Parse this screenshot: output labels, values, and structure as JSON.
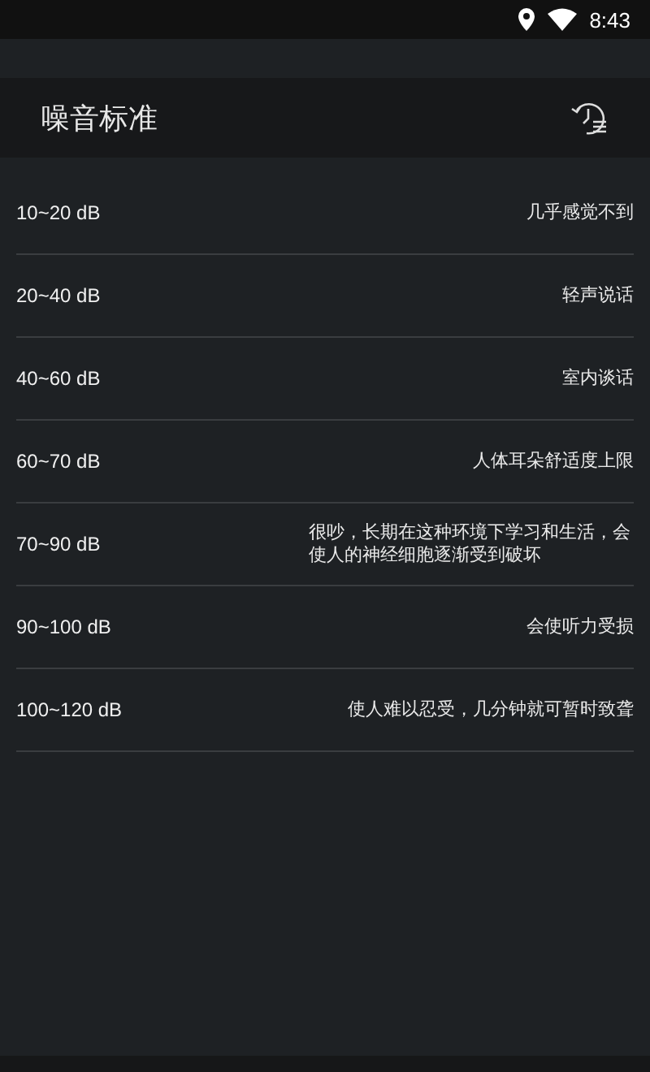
{
  "status_bar": {
    "time": "8:43"
  },
  "header": {
    "title": "噪音标准"
  },
  "rows": [
    {
      "range": "10~20 dB",
      "description": "几乎感觉不到"
    },
    {
      "range": "20~40 dB",
      "description": "轻声说话"
    },
    {
      "range": "40~60 dB",
      "description": "室内谈话"
    },
    {
      "range": "60~70 dB",
      "description": "人体耳朵舒适度上限"
    },
    {
      "range": "70~90 dB",
      "description": "很吵，长期在这种环境下学习和生活，会使人的神经细胞逐渐受到破坏"
    },
    {
      "range": "90~100 dB",
      "description": "会使听力受损"
    },
    {
      "range": "100~120 dB",
      "description": "使人难以忍受，几分钟就可暂时致聋"
    }
  ]
}
